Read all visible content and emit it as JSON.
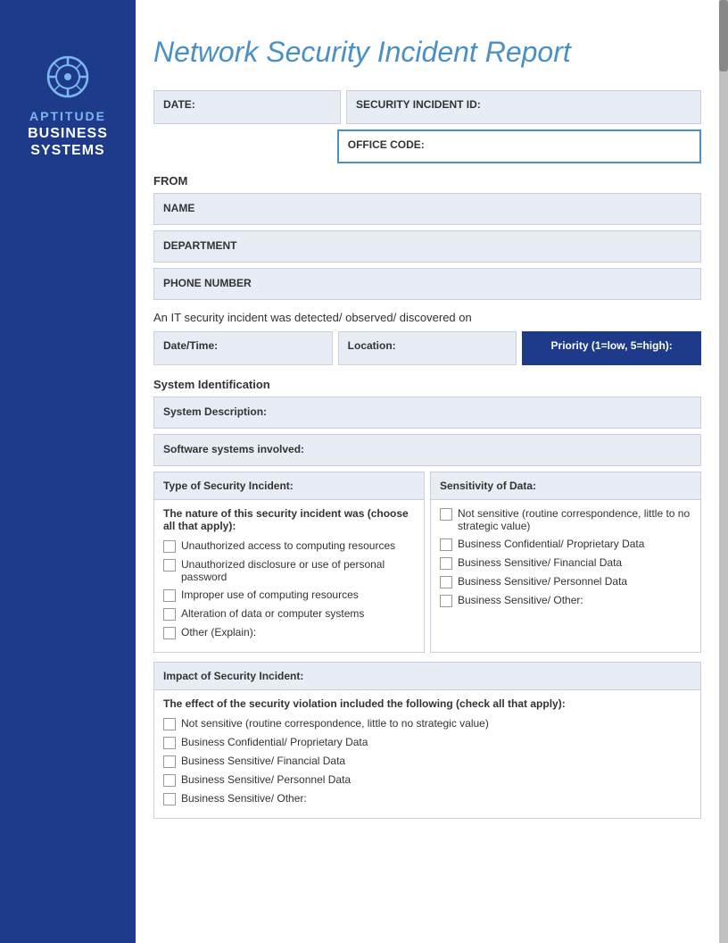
{
  "sidebar": {
    "brand_top": "APTITUDE",
    "brand_bottom_line1": "BUSINESS",
    "brand_bottom_line2": "SYSTEMS"
  },
  "header": {
    "title": "Network Security Incident Report"
  },
  "form": {
    "date_label": "DATE:",
    "security_id_label": "SECURITY INCIDENT ID:",
    "office_code_label": "OFFICE CODE:",
    "from_label": "FROM",
    "name_label": "NAME",
    "department_label": "DEPARTMENT",
    "phone_label": "PHONE NUMBER",
    "it_security_text": "An IT security incident was detected/ observed/ discovered on",
    "datetime_label": "Date/Time:",
    "location_label": "Location:",
    "priority_label": "Priority (1=low, 5=high):",
    "system_id_label": "System Identification",
    "system_desc_label": "System Description:",
    "software_label": "Software systems involved:",
    "type_section_header": "Type of Security Incident:",
    "type_subtitle": "The nature of this security incident was (choose all that apply):",
    "type_items": [
      "Unauthorized access to computing resources",
      "Unauthorized disclosure or use of personal password",
      "Improper use of computing resources",
      "Alteration of data or computer systems",
      "Other (Explain):"
    ],
    "sensitivity_header": "Sensitivity of Data:",
    "sensitivity_items": [
      "Not sensitive (routine correspondence, little to no strategic value)",
      "Business Confidential/ Proprietary Data",
      "Business Sensitive/ Financial Data",
      "Business Sensitive/ Personnel Data",
      "Business Sensitive/ Other:"
    ],
    "impact_header": "Impact of Security Incident:",
    "impact_subtitle": "The effect of the security violation included the following (check all that apply):",
    "impact_items": [
      "Not sensitive (routine correspondence, little to no strategic value)",
      "Business Confidential/ Proprietary Data",
      "Business Sensitive/ Financial Data",
      "Business Sensitive/ Personnel Data",
      "Business Sensitive/ Other:"
    ]
  }
}
